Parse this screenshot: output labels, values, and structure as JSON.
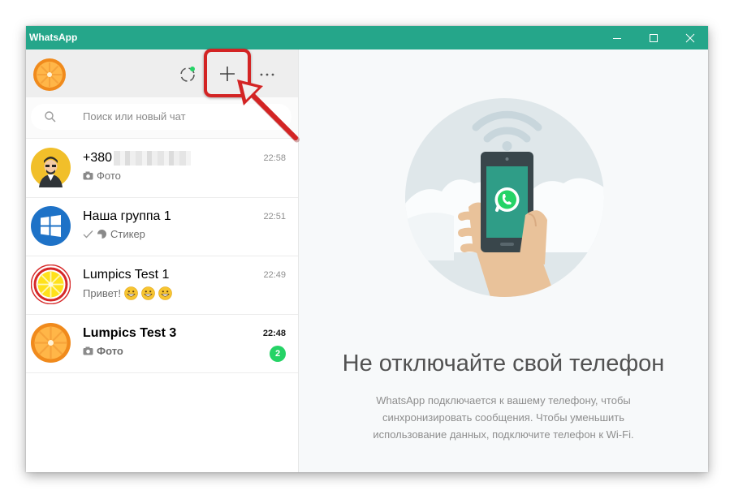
{
  "window": {
    "title": "WhatsApp"
  },
  "sidebar": {
    "search_placeholder": "Поиск или новый чат",
    "chats": [
      {
        "name": "+380",
        "time": "22:58",
        "preview": "Фото",
        "icon": "camera-icon"
      },
      {
        "name": "Наша группа 1",
        "time": "22:51",
        "preview": "Стикер",
        "icon": "sticker-icon"
      },
      {
        "name": "Lumpics Test 1",
        "time": "22:49",
        "preview": "Привет!"
      },
      {
        "name": "Lumpics Test 3",
        "time": "22:48",
        "preview": "Фото",
        "unread": "2",
        "icon": "camera-icon"
      }
    ]
  },
  "main": {
    "title": "Не отключайте свой телефон",
    "description": "WhatsApp подключается к вашему телефону, чтобы синхронизировать сообщения. Чтобы уменьшить использование данных, подключите телефон к Wi-Fi."
  },
  "colors": {
    "titlebar": "#25a68a",
    "accent_green": "#25d366",
    "annotation_red": "#d32424"
  }
}
